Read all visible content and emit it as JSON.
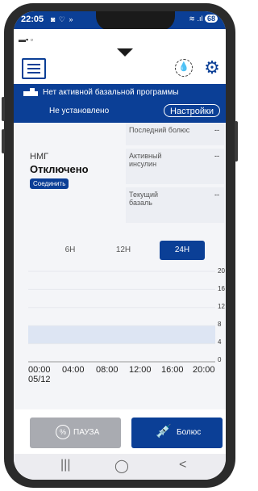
{
  "status_bar": {
    "time": "22:05",
    "battery": "68",
    "signal": "$∶ .∥∥"
  },
  "header": {
    "menu_icon": "hamburger-menu-icon",
    "center_icon": "chevron-down-icon",
    "drop_icon": "insulin-drop-icon",
    "settings_icon": "gear-icon"
  },
  "basal": {
    "title": "Нет активной базальной программы",
    "status": "Не установлено",
    "settings_label": "Настройки"
  },
  "cgm": {
    "label": "НМГ",
    "state": "Отключено",
    "connect_label": "Соединить"
  },
  "cards": [
    {
      "key": "Последний болюс",
      "value": "--"
    },
    {
      "key": "Активный инсулин",
      "value": "--"
    },
    {
      "key": "Текущий базаль",
      "value": "--"
    }
  ],
  "ranges": {
    "items": [
      "6H",
      "12H",
      "24H"
    ],
    "selected": "24H"
  },
  "chart_data": {
    "type": "area",
    "y_ticks": [
      "20",
      "16",
      "12",
      "8",
      "4",
      "0"
    ],
    "x_ticks": [
      "00:00",
      "04:00",
      "08:00",
      "12:00",
      "16:00",
      "20:00"
    ],
    "x_date": "05/12",
    "target_range": [
      4,
      8
    ],
    "ylim": [
      0,
      20
    ],
    "series": []
  },
  "actions": {
    "pause_label": "ПАУЗА",
    "bolus_label": "Болюс"
  },
  "nav": {
    "recent": "|||",
    "home": "◯",
    "back": "<"
  }
}
